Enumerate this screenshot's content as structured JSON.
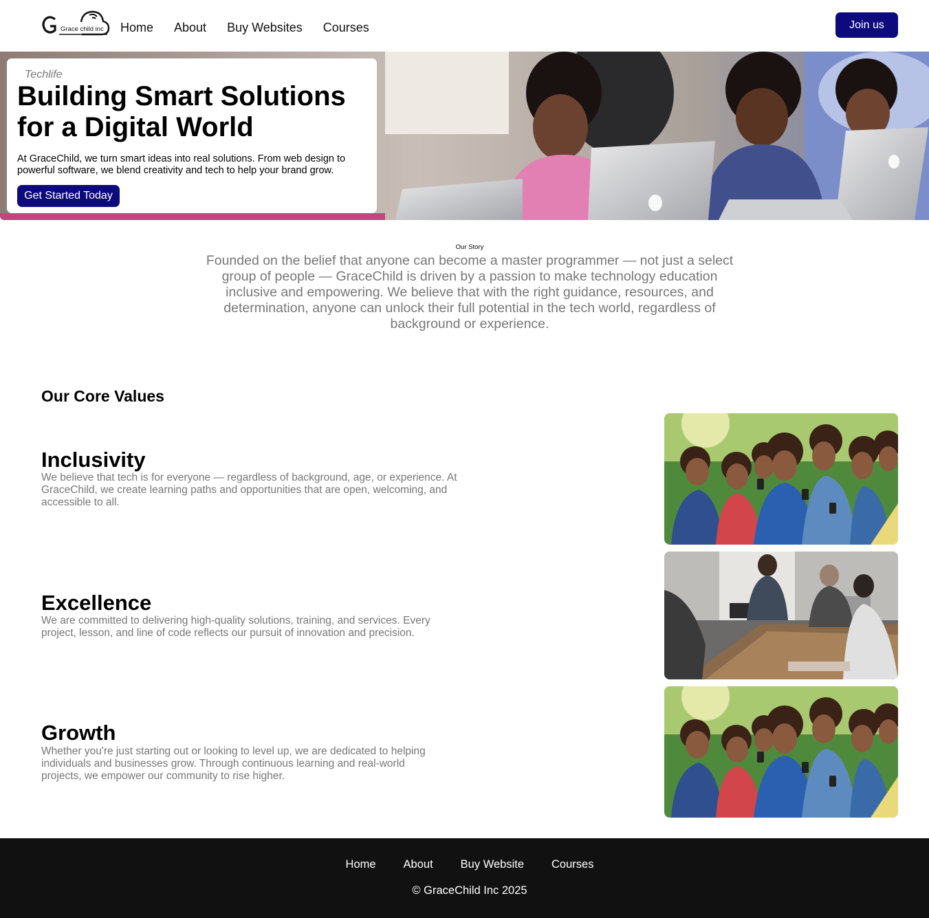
{
  "header": {
    "logo_text": "Grace child inc",
    "nav": [
      "Home",
      "About",
      "Buy Websites",
      "Courses"
    ],
    "join_label": "Join us"
  },
  "hero": {
    "kicker": "Techlife",
    "title": "Building Smart Solutions for a Digital World",
    "text": "At GraceChild, we turn smart ideas into real solutions. From web design to powerful software, we blend creativity and tech to help your brand grow.",
    "cta_label": "Get Started Today"
  },
  "story": {
    "label": "Our Story",
    "text": "Founded on the belief that anyone can become a master programmer — not just a select group of people — GraceChild is driven by a passion to make technology education inclusive and empowering. We believe that with the right guidance, resources, and determination, anyone can unlock their full potential in the tech world, regardless of background or experience."
  },
  "core_values": {
    "title": "Our Core Values",
    "items": [
      {
        "title": "Inclusivity",
        "text": "We believe that tech is for everyone — regardless of background, age, or experience. At GraceChild, we create learning paths and opportunities that are open, welcoming, and accessible to all."
      },
      {
        "title": "Excellence",
        "text": "We are committed to delivering high-quality solutions, training, and services. Every project, lesson, and line of code reflects our pursuit of innovation and precision."
      },
      {
        "title": "Growth",
        "text": "Whether you're just starting out or looking to level up, we are dedicated to helping individuals and businesses grow. Through continuous learning and real-world projects, we empower our community to rise higher."
      }
    ]
  },
  "footer": {
    "nav": [
      "Home",
      "About",
      "Buy Website",
      "Courses"
    ],
    "copyright": "© GraceChild Inc 2025"
  },
  "colors": {
    "primary": "#0d0a7e",
    "muted_text": "#777777",
    "footer_bg": "#111111"
  }
}
